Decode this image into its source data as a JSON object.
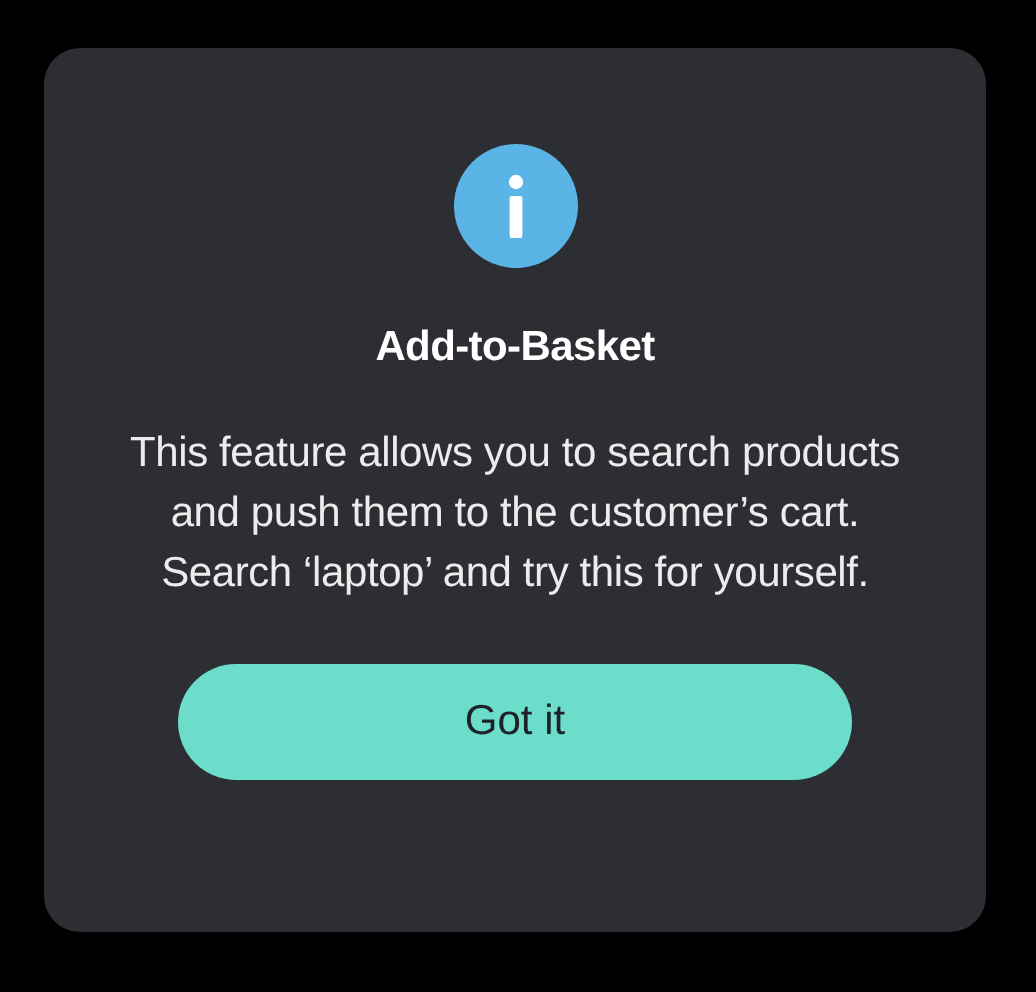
{
  "dialog": {
    "title": "Add-to-Basket",
    "message": "This feature allows you to search products and push them to the customer’s cart. Search ‘laptop’ and try this for yourself.",
    "button": "Got it"
  }
}
